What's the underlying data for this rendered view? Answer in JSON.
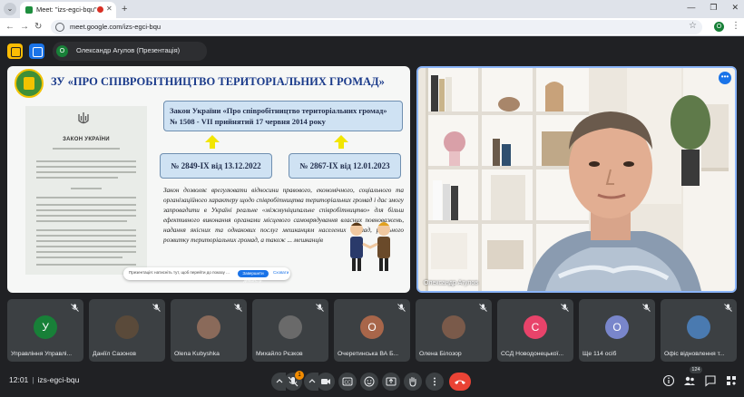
{
  "browser": {
    "tab_title": "Meet: \"izs-egci-bqu\"",
    "url": "meet.google.com/izs-egci-bqu",
    "profile_initial": "O"
  },
  "meet": {
    "presenter_initial": "О",
    "presenter_label": "Олександр Агулов (Презентація)",
    "camera_name": "Олександр Агулов",
    "time": "12:01",
    "meeting_code": "izs-egci-bqu",
    "reactions_badge": "1",
    "people_count": "124"
  },
  "slide": {
    "title": "ЗУ «ПРО СПІВРОБІТНИЦТВО ТЕРИТОРІАЛЬНИХ ГРОМАД»",
    "doc_title": "ЗАКОН УКРАЇНИ",
    "box_main": "Закон України «Про співробітництво територіальних громад» № 1508 - VII прийнятий 17 червня 2014 року",
    "box_left": "№ 2849-IX від 13.12.2022",
    "box_right": "№ 2867-IX від 12.01.2023",
    "body": "Закон дозволяє врегулювати відносини правового, економічного, соціального та організаційного характеру щодо співробітництва територіальних громад і дає змогу запровадити в Україні реальне «міжмуніципальне співробітництво» для більш ефективного виконання органами місцевого самоврядування власних повноважень, надання якісних та однакових послуг мешканцям населених громад, реального розвитку територіальних громад, а також ... мешканців",
    "toast_text": "Презентація: натисніть тут, щоб перейти до показу ...",
    "toast_button": "Завершити демонстр.",
    "toast_close": "Сховати"
  },
  "participants": [
    {
      "name": "Управління Управлі...",
      "initial": "У",
      "color": "#188038"
    },
    {
      "name": "Даніїл Сазонов",
      "initial": "",
      "color": "#5a4a3a"
    },
    {
      "name": "Olena Kubyshka",
      "initial": "",
      "color": "#8a6a5a"
    },
    {
      "name": "Михайло Рєзков",
      "initial": "",
      "color": "#6a6a6a"
    },
    {
      "name": "Очеретинська ВА Б...",
      "initial": "О",
      "color": "#a8664a"
    },
    {
      "name": "Олена Білозор",
      "initial": "",
      "color": "#7a5a4a"
    },
    {
      "name": "ССД Новодонецької...",
      "initial": "С",
      "color": "#e8436a"
    },
    {
      "name": "Ще 114 осіб",
      "initial": "О",
      "color": "#7986cb"
    },
    {
      "name": "Офіс відновлення т...",
      "initial": "",
      "color": "#4a7ab0"
    }
  ],
  "colors": {
    "accent": "#8ab4f8",
    "hangup": "#ea4335",
    "slide_title": "#1a3a8a",
    "box_fill": "#cfe2f3"
  },
  "icons": [
    "tab-menu-icon",
    "close-icon",
    "new-tab-icon",
    "back-icon",
    "forward-icon",
    "reload-icon",
    "star-icon",
    "mic-off-icon",
    "camera-icon",
    "caption-icon",
    "emoji-icon",
    "present-icon",
    "hand-icon",
    "more-icon",
    "hangup-icon",
    "info-icon",
    "people-icon",
    "chat-icon",
    "activities-icon"
  ]
}
